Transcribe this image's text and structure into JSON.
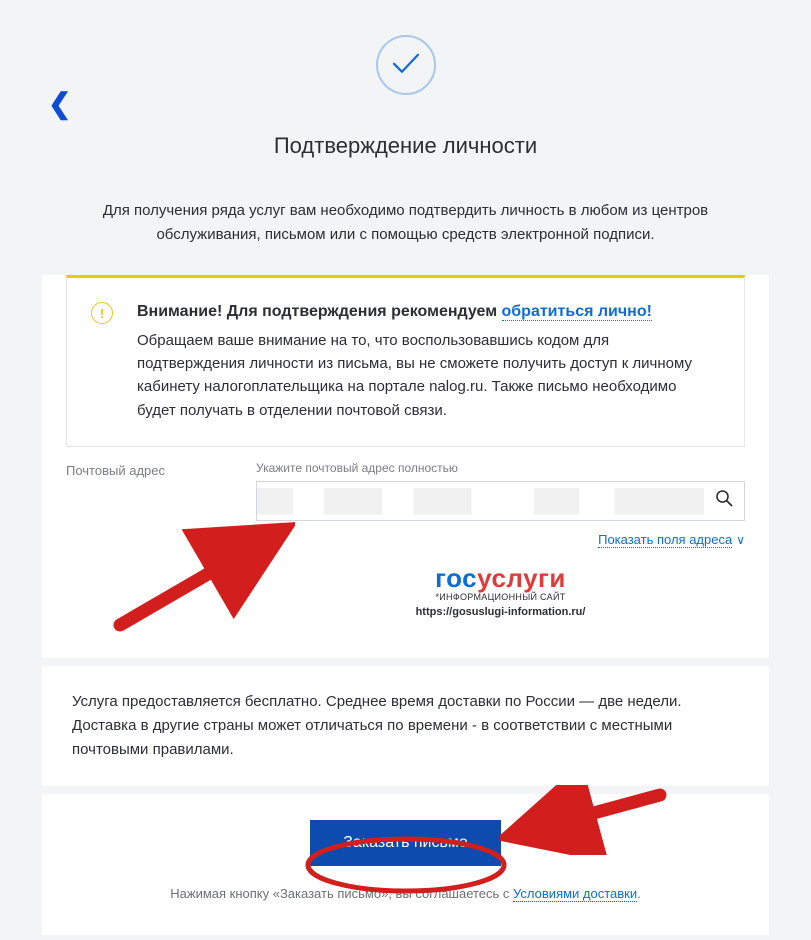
{
  "header": {
    "title": "Подтверждение личности",
    "intro": "Для получения ряда услуг вам необходимо подтвердить личность в любом из центров обслуживания, письмом или с помощью средств электронной подписи."
  },
  "notice": {
    "bold": "Внимание! Для подтверждения рекомендуем ",
    "link": "обратиться лично!",
    "body": "Обращаем ваше внимание на то, что воспользовавшись кодом для подтверждения личности из письма, вы не сможете получить доступ к личному кабинету налогоплательщика на портале nalog.ru. Также письмо необходимо будет получать в отделении почтовой связи."
  },
  "address": {
    "label": "Почтовый адрес",
    "hint": "Укажите почтовый адрес полностью",
    "value": "",
    "show_fields": "Показать поля адреса"
  },
  "logo": {
    "part1": "гос",
    "part2": "услуги",
    "sub": "*ИНФОРМАЦИОННЫЙ САЙТ",
    "url": "https://gosuslugi-information.ru/"
  },
  "note": "Услуга предоставляется бесплатно. Среднее время доставки по России — две недели. Доставка в другие страны может отличаться по времени - в соответствии с местными почтовыми правилами.",
  "cta": {
    "button": "Заказать письмо",
    "disclaimer_prefix": "Нажимая кнопку «Заказать письмо», вы соглашаетесь с ",
    "disclaimer_link": "Условиями доставки",
    "disclaimer_suffix": "."
  }
}
